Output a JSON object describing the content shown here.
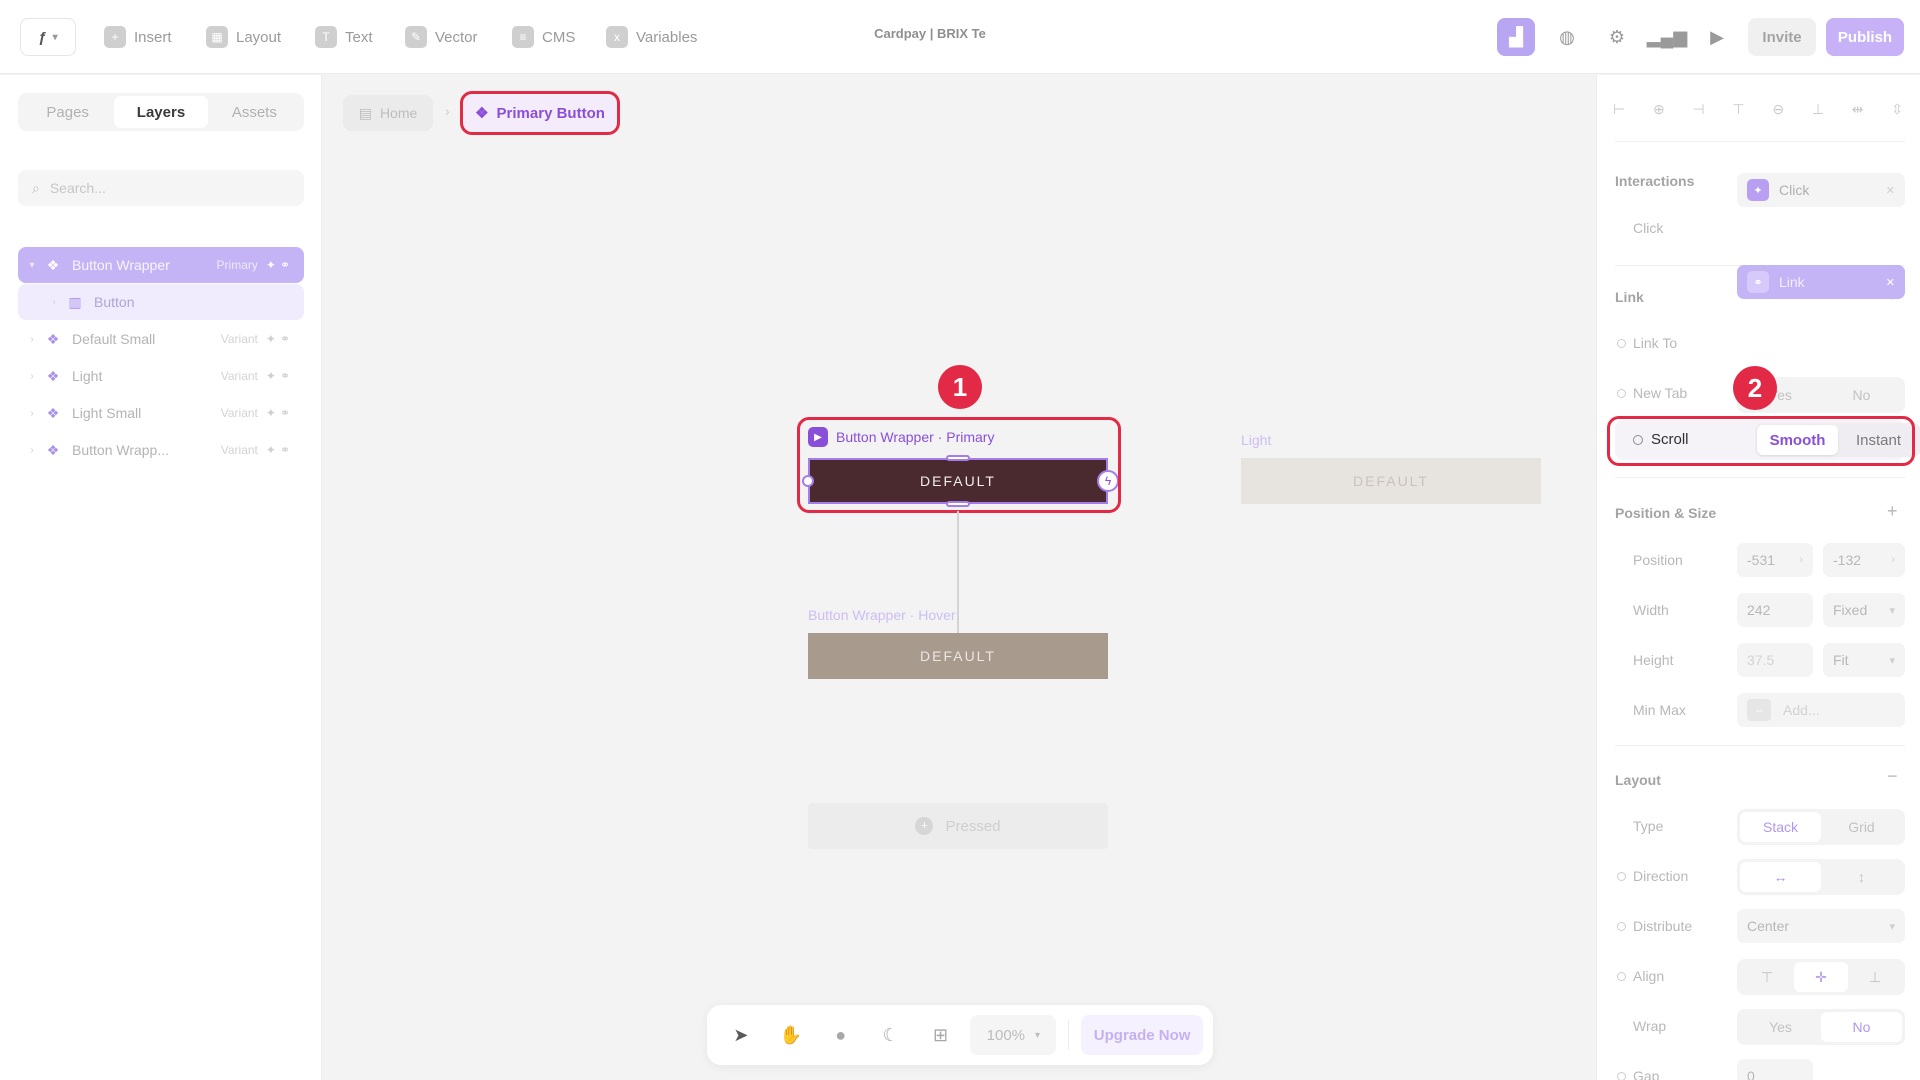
{
  "topbar": {
    "doc_title": "Cardpay | BRIX Te",
    "menu": [
      {
        "label": "Insert",
        "icon": "plus-square-icon"
      },
      {
        "label": "Layout",
        "icon": "layout-icon"
      },
      {
        "label": "Text",
        "icon": "text-icon"
      },
      {
        "label": "Vector",
        "icon": "vector-pen-icon"
      },
      {
        "label": "CMS",
        "icon": "database-icon"
      },
      {
        "label": "Variables",
        "icon": "variables-icon"
      }
    ],
    "invite_label": "Invite",
    "publish_label": "Publish",
    "accent_color": "#b9a6f3"
  },
  "left_panel": {
    "tabs": [
      "Pages",
      "Layers",
      "Assets"
    ],
    "active_tab": "Layers",
    "search_placeholder": "Search...",
    "layers": [
      {
        "name": "Button Wrapper",
        "tag": "Primary",
        "selected": true
      },
      {
        "name": "Button",
        "tag": "",
        "child": true
      },
      {
        "name": "Default Small",
        "tag": "Variant"
      },
      {
        "name": "Light",
        "tag": "Variant"
      },
      {
        "name": "Light Small",
        "tag": "Variant"
      },
      {
        "name": "Button Wrapp...",
        "tag": "Variant"
      }
    ]
  },
  "canvas": {
    "breadcrumb_home": "Home",
    "breadcrumb_current": "Primary Button",
    "primary_frame_label": "Button Wrapper · Primary",
    "primary_button_text": "DEFAULT",
    "light_frame_label": "Light",
    "light_button_text": "DEFAULT",
    "hover_frame_label": "Button Wrapper · Hover",
    "hover_button_text": "DEFAULT",
    "pressed_label": "Pressed",
    "step_badges": [
      "1",
      "2"
    ],
    "highlight_color": "#e22a46"
  },
  "bottom_toolbar": {
    "zoom": "100%",
    "upgrade_label": "Upgrade Now"
  },
  "right_panel": {
    "interactions": {
      "title": "Interactions",
      "click_label": "Click",
      "click_value": "Click"
    },
    "link": {
      "title": "Link",
      "link_to_label": "Link To",
      "link_value": "Link",
      "new_tab_label": "New Tab",
      "new_tab_options": [
        "Yes",
        "No"
      ],
      "scroll_label": "Scroll",
      "scroll_options": [
        "Smooth",
        "Instant"
      ],
      "scroll_selected": "Smooth"
    },
    "position_size": {
      "title": "Position & Size",
      "position_label": "Position",
      "position_x": "-531",
      "position_y": "-132",
      "width_label": "Width",
      "width_value": "242",
      "width_mode": "Fixed",
      "height_label": "Height",
      "height_value": "37.5",
      "height_mode": "Fit",
      "minmax_label": "Min Max",
      "minmax_value": "Add..."
    },
    "layout": {
      "title": "Layout",
      "type_label": "Type",
      "type_options": [
        "Stack",
        "Grid"
      ],
      "direction_label": "Direction",
      "distribute_label": "Distribute",
      "distribute_value": "Center",
      "align_label": "Align",
      "wrap_label": "Wrap",
      "wrap_options": [
        "Yes",
        "No"
      ],
      "gap_label": "Gap",
      "gap_value": "0"
    }
  }
}
